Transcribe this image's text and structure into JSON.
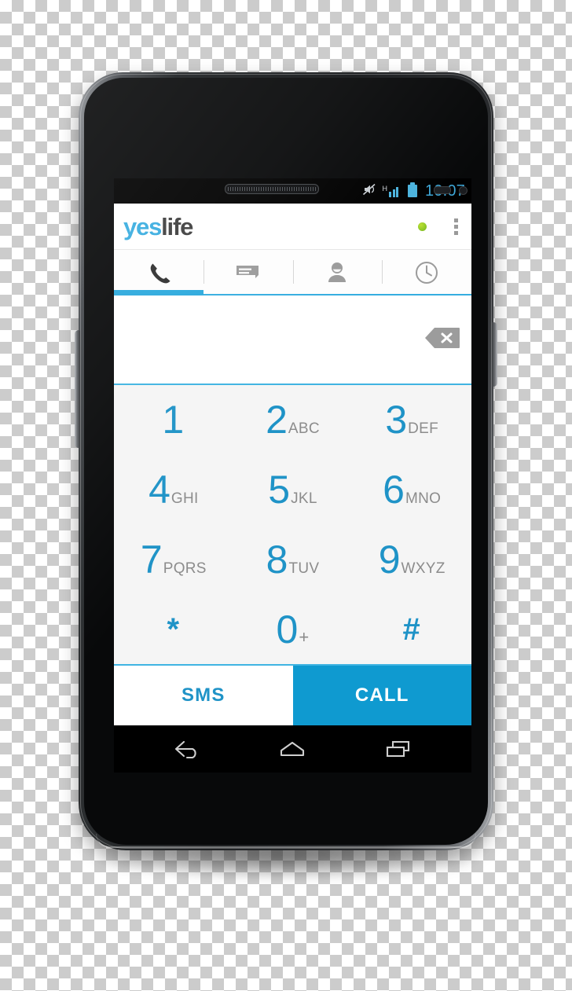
{
  "device": {
    "type": "android-smartphone",
    "hardware": {
      "earpiece": "earpiece-speaker",
      "front_camera": "front-camera",
      "proximity_sensor": "proximity-sensor",
      "light_sensor": "ambient-light-sensor",
      "volume_button": "volume-rocker",
      "power_button": "power-button"
    }
  },
  "statusbar": {
    "clock": "10:07",
    "icons": [
      {
        "name": "mute-icon",
        "label": "silent"
      },
      {
        "name": "signal-icon",
        "label": "H",
        "bars": 4
      },
      {
        "name": "battery-icon",
        "label": "battery-full"
      }
    ]
  },
  "header": {
    "logo_part1": "yes",
    "logo_part2": "life",
    "status_dot": {
      "name": "online-status-dot",
      "color": "#8fc828"
    },
    "overflow_label": "More options"
  },
  "tabs": [
    {
      "id": "dialer",
      "icon": "phone-icon",
      "label": "Dialer",
      "active": true
    },
    {
      "id": "messages",
      "icon": "message-icon",
      "label": "Messages",
      "active": false
    },
    {
      "id": "contacts",
      "icon": "contact-icon",
      "label": "Contacts",
      "active": false
    },
    {
      "id": "history",
      "icon": "clock-icon",
      "label": "History",
      "active": false
    }
  ],
  "number_field": {
    "value": "",
    "placeholder": "",
    "backspace_label": "Delete"
  },
  "dialpad": {
    "rows": [
      [
        {
          "digit": "1",
          "letters": ""
        },
        {
          "digit": "2",
          "letters": "ABC"
        },
        {
          "digit": "3",
          "letters": "DEF"
        }
      ],
      [
        {
          "digit": "4",
          "letters": "GHI"
        },
        {
          "digit": "5",
          "letters": "JKL"
        },
        {
          "digit": "6",
          "letters": "MNO"
        }
      ],
      [
        {
          "digit": "7",
          "letters": "PQRS"
        },
        {
          "digit": "8",
          "letters": "TUV"
        },
        {
          "digit": "9",
          "letters": "WXYZ"
        }
      ],
      [
        {
          "digit": "*",
          "letters": ""
        },
        {
          "digit": "0",
          "letters": "+"
        },
        {
          "digit": "#",
          "letters": ""
        }
      ]
    ]
  },
  "actions": {
    "sms_label": "SMS",
    "call_label": "CALL"
  },
  "navbar": [
    {
      "id": "back",
      "icon": "back-icon",
      "label": "Back"
    },
    {
      "id": "home",
      "icon": "home-icon",
      "label": "Home"
    },
    {
      "id": "recents",
      "icon": "recents-icon",
      "label": "Recent apps"
    }
  ],
  "colors": {
    "brand_blue": "#3aade0",
    "accent_blue": "#1f93c7",
    "call_button": "#0f9ad0",
    "logo_dark": "#3f3f3f",
    "dialpad_bg": "#f5f5f5",
    "status_green": "#8fc828",
    "status_clock": "#3ea6d6"
  }
}
